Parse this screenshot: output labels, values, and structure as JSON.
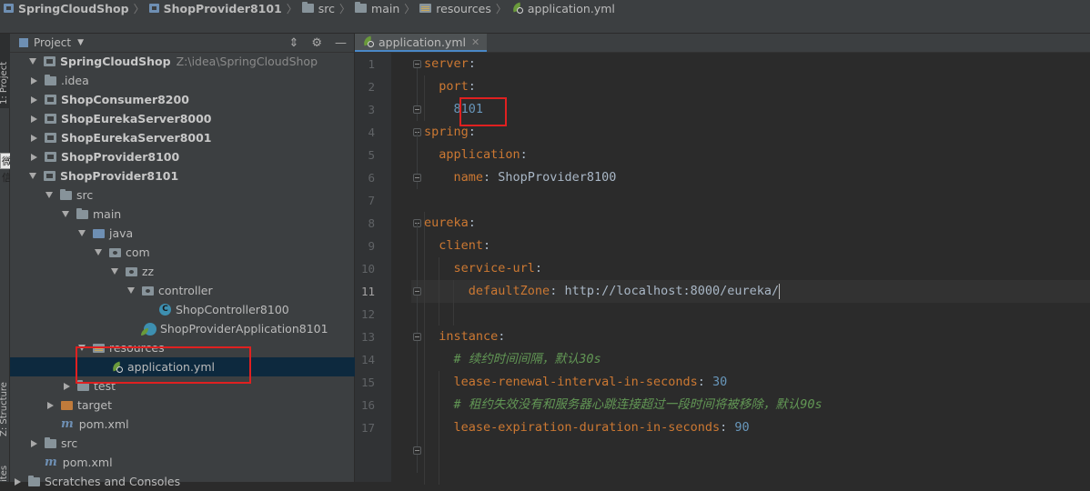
{
  "breadcrumbs": [
    {
      "label": "SpringCloudShop",
      "bold": true,
      "icon": "module-folder-icon"
    },
    {
      "label": "ShopProvider8101",
      "bold": true,
      "icon": "module-folder-icon"
    },
    {
      "label": "src",
      "bold": false,
      "icon": "folder-icon"
    },
    {
      "label": "main",
      "bold": false,
      "icon": "folder-icon"
    },
    {
      "label": "resources",
      "bold": false,
      "icon": "resources-folder-icon"
    },
    {
      "label": "application.yml",
      "bold": false,
      "icon": "spring-yml-icon"
    }
  ],
  "side_strip": {
    "project_tab": "1: Project",
    "structure_tab": "Z: Structure",
    "favorites_tab": "ites",
    "tooltip": "微信"
  },
  "project_panel": {
    "title": "Project",
    "tools": [
      "settings-gear",
      "collapse"
    ],
    "tree": [
      {
        "label": "SpringCloudShop",
        "hint": "Z:\\idea\\SpringCloudShop",
        "bold": true,
        "expanded": true
      },
      {
        "label": ".idea",
        "bold": false,
        "expanded": false
      },
      {
        "label": "ShopConsumer8200",
        "bold": true,
        "expanded": false
      },
      {
        "label": "ShopEurekaServer8000",
        "bold": true,
        "expanded": false
      },
      {
        "label": "ShopEurekaServer8001",
        "bold": true,
        "expanded": false
      },
      {
        "label": "ShopProvider8100",
        "bold": true,
        "expanded": false
      },
      {
        "label": "ShopProvider8101",
        "bold": true,
        "expanded": true
      },
      {
        "label": "src",
        "bold": false,
        "expanded": true
      },
      {
        "label": "main",
        "bold": false,
        "expanded": true
      },
      {
        "label": "java",
        "bold": false,
        "expanded": true
      },
      {
        "label": "com",
        "bold": false,
        "expanded": true
      },
      {
        "label": "zz",
        "bold": false,
        "expanded": true
      },
      {
        "label": "controller",
        "bold": false,
        "expanded": true
      },
      {
        "label": "ShopController8100",
        "bold": false
      },
      {
        "label": "ShopProviderApplication8101",
        "bold": false
      },
      {
        "label": "resources",
        "bold": false,
        "expanded": true
      },
      {
        "label": "application.yml",
        "bold": false,
        "selected": true
      },
      {
        "label": "test",
        "bold": false,
        "expanded": false
      },
      {
        "label": "target",
        "bold": false,
        "expanded": false
      },
      {
        "label": "pom.xml",
        "bold": false
      },
      {
        "label": "src",
        "bold": false,
        "expanded": false
      },
      {
        "label": "pom.xml",
        "bold": false
      },
      {
        "label": "Scratches and Consoles",
        "bold": false,
        "expanded": false
      }
    ]
  },
  "editor": {
    "tab_label": "application.yml",
    "current_line": 11,
    "lines": [
      {
        "n": "1",
        "text": "server:"
      },
      {
        "n": "2",
        "text": "  port:"
      },
      {
        "n": "3",
        "text": "    8101"
      },
      {
        "n": "4",
        "text": "spring:"
      },
      {
        "n": "5",
        "text": "  application:"
      },
      {
        "n": "6",
        "text": "    name: ShopProvider8100"
      },
      {
        "n": "7",
        "text": ""
      },
      {
        "n": "8",
        "text": "eureka:"
      },
      {
        "n": "9",
        "text": "  client:"
      },
      {
        "n": "10",
        "text": "    service-url:"
      },
      {
        "n": "11",
        "text": "      defaultZone: http://localhost:8000/eureka/"
      },
      {
        "n": "12",
        "text": ""
      },
      {
        "n": "13",
        "text": "  instance:"
      },
      {
        "n": "14",
        "text": "    # 续约时间间隔，默认30s"
      },
      {
        "n": "15",
        "text": "    lease-renewal-interval-in-seconds: 30"
      },
      {
        "n": "16",
        "text": "    # 租约失效没有和服务器心跳连接超过一段时间将被移除，默认90s"
      },
      {
        "n": "17",
        "text": "    lease-expiration-duration-in-seconds: 90"
      }
    ]
  },
  "colors": {
    "key": "#cc7832",
    "value": "#a9b7c6",
    "number": "#6897bb",
    "comment": "#629755",
    "highlight_box": "#e02020",
    "selection": "#0d293e"
  }
}
